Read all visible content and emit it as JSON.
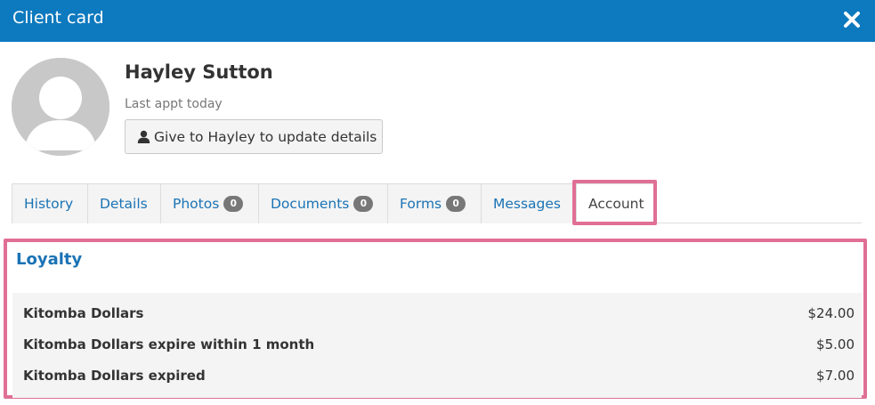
{
  "window": {
    "title": "Client card"
  },
  "client": {
    "name": "Hayley Sutton",
    "last_appt": "Last appt today",
    "update_button_label": "Give to Hayley to update details"
  },
  "tabs": [
    {
      "label": "History",
      "count": null,
      "active": false
    },
    {
      "label": "Details",
      "count": null,
      "active": false
    },
    {
      "label": "Photos",
      "count": "0",
      "active": false
    },
    {
      "label": "Documents",
      "count": "0",
      "active": false
    },
    {
      "label": "Forms",
      "count": "0",
      "active": false
    },
    {
      "label": "Messages",
      "count": null,
      "active": false
    },
    {
      "label": "Account",
      "count": null,
      "active": true
    }
  ],
  "loyalty": {
    "title": "Loyalty",
    "rows": [
      {
        "label": "Kitomba Dollars",
        "value": "$24.00"
      },
      {
        "label": "Kitomba Dollars expire within 1 month",
        "value": "$5.00"
      },
      {
        "label": "Kitomba Dollars expired",
        "value": "$7.00"
      }
    ]
  },
  "colors": {
    "titlebar": "#0d79be",
    "link": "#1a73b5",
    "highlight": "#e06f96",
    "badge": "#777777"
  },
  "icons": {
    "close": "close-icon",
    "user": "user-icon",
    "avatar": "avatar-placeholder"
  }
}
